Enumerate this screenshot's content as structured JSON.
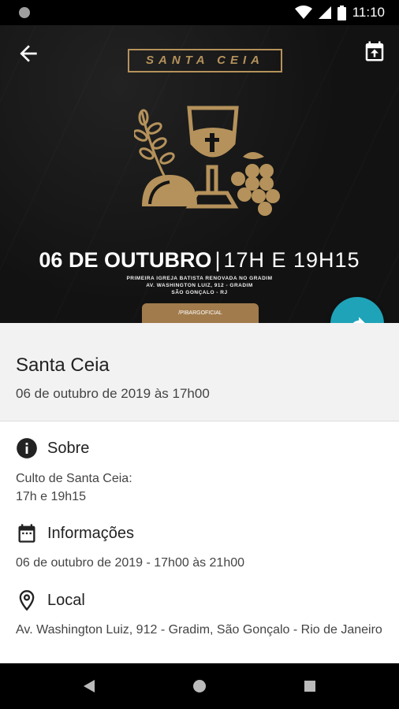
{
  "status_bar": {
    "time": "11:10"
  },
  "banner": {
    "poster_title": "SANTA CEIA",
    "poster_date": "06 DE OUTUBRO",
    "poster_time": "17H E 19H15",
    "poster_church": "PRIMEIRA IGREJA BATISTA RENOVADA NO GRADIM",
    "poster_address": "AV. WASHINGTON LUIZ, 912 - GRADIM",
    "poster_city": "SÃO GONÇALO - RJ",
    "poster_social": "/PIBARGOFICIAL"
  },
  "event": {
    "title": "Santa Ceia",
    "datetime": "06 de outubro de 2019 às 17h00"
  },
  "about": {
    "heading": "Sobre",
    "line1": "Culto de Santa Ceia:",
    "line2": "17h e 19h15"
  },
  "info": {
    "heading": "Informações",
    "text": "06 de outubro de 2019 - 17h00 às 21h00"
  },
  "location": {
    "heading": "Local",
    "text": "Av. Washington Luiz, 912 - Gradim, São Gonçalo - Rio de Janeiro"
  },
  "icons": {
    "back": "arrow-left-icon",
    "calendar_add": "calendar-add-icon",
    "share": "share-icon",
    "info": "info-icon",
    "calendar": "calendar-icon",
    "location": "location-pin-icon"
  },
  "colors": {
    "accent": "#1fa3b8",
    "gold": "#b5925b",
    "banner_bg": "#141414"
  }
}
